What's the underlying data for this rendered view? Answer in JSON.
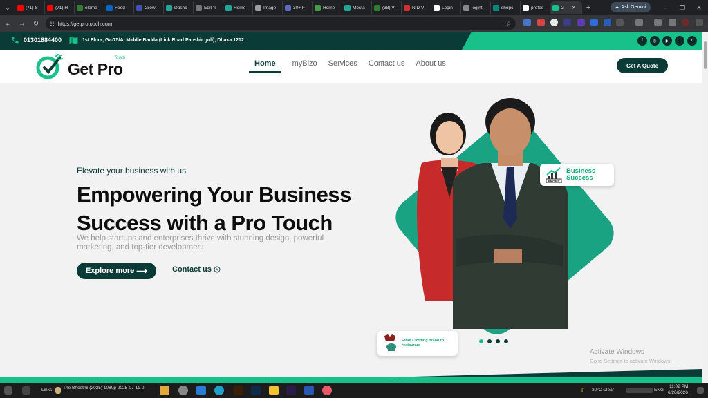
{
  "browser": {
    "tabs": [
      {
        "label": "(71) S",
        "color": "#ff0000"
      },
      {
        "label": "(71) H",
        "color": "#ff0000"
      },
      {
        "label": "eleme",
        "color": "#2e7d32"
      },
      {
        "label": "Feed",
        "color": "#0a66c2"
      },
      {
        "label": "Growt",
        "color": "#3f51b5"
      },
      {
        "label": "Dashb",
        "color": "#26a69a"
      },
      {
        "label": "Edit \"l",
        "color": "#777777"
      },
      {
        "label": "Home",
        "color": "#26a69a"
      },
      {
        "label": "Image",
        "color": "#9e9e9e"
      },
      {
        "label": "30+ F",
        "color": "#5c6bc0"
      },
      {
        "label": "Home",
        "color": "#43a047"
      },
      {
        "label": "Mosta",
        "color": "#26a69a"
      },
      {
        "label": "(38) V",
        "color": "#2e7d32"
      },
      {
        "label": "NID V",
        "color": "#d32f2f"
      },
      {
        "label": "Login",
        "color": "#ffffff"
      },
      {
        "label": "logint",
        "color": "#888888"
      },
      {
        "label": "shopc",
        "color": "#00897b"
      },
      {
        "label": "profes",
        "color": "#ffffff"
      },
      {
        "label": "G",
        "color": "#19c18a"
      }
    ],
    "ask_gemini": "Ask Gemini",
    "url": "https://getprotouch.com"
  },
  "topbar": {
    "phone": "01301884400",
    "address": "1st Floor, Ga-75/A, Middle Badda (Link Road Panshir goli), Dhaka 1212",
    "socials": [
      "facebook-icon",
      "instagram-icon",
      "youtube-icon",
      "tiktok-icon",
      "linkedin-icon"
    ]
  },
  "header": {
    "logo_text": "Get Pro",
    "logo_tag": "Touch",
    "nav": [
      "Home",
      "myBizo",
      "Services",
      "Contact us",
      "About us"
    ],
    "cta": "Get A Quote"
  },
  "hero": {
    "eyebrow": "Elevate your business with us",
    "headline": "Empowering Your Business Success with a Pro Touch",
    "subtext": "We help startups and enterprises thrive with stunning design, powerful marketing, and top-tier development",
    "explore": "Explore more",
    "contact": "Contact us",
    "badge1": "Business Success",
    "badge1_icon_label": "PROFIT",
    "badge2": "From Clothing brand to restaurant",
    "slides": 4,
    "active_slide": 0
  },
  "windows": {
    "activate": "Activate Windows",
    "activate_sub": "Go to Settings to activate Windows."
  },
  "taskbar": {
    "links": "Links",
    "media": "The Bhootnii (2025) 1080p 2025-07-19 0",
    "weather": "30°C  Clear",
    "lang": "ENG",
    "time": "11:02 PM",
    "date": "6/26/2026"
  },
  "colors": {
    "brand_dark": "#0b3b36",
    "brand_green": "#19c18a"
  }
}
